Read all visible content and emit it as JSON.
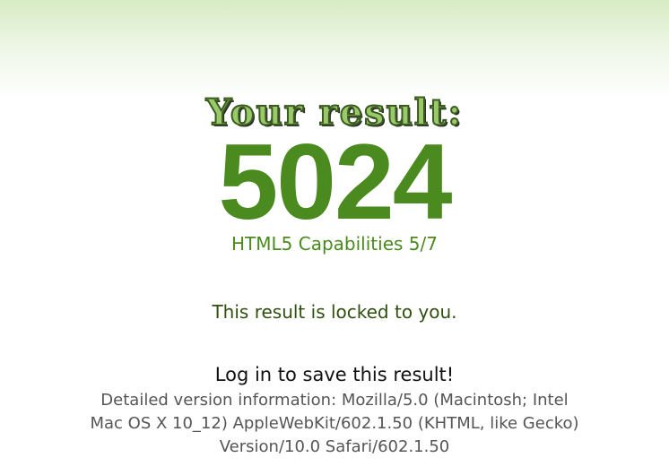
{
  "result": {
    "heading": "Your result:",
    "score": "5024",
    "capabilities": "HTML5 Capabilities 5/7"
  },
  "status": {
    "locked_message": "This result is locked to you."
  },
  "actions": {
    "login_prompt": "Log in to save this result!"
  },
  "details": {
    "version_info": "Detailed version information: Mozilla/5.0 (Macintosh; Intel Mac OS X 10_12) AppleWebKit/602.1.50 (KHTML, like Gecko) Version/10.0 Safari/602.1.50"
  },
  "colors": {
    "accent_green": "#4a8a1e",
    "dark_green": "#2f4f0f",
    "gray_text": "#555555"
  }
}
